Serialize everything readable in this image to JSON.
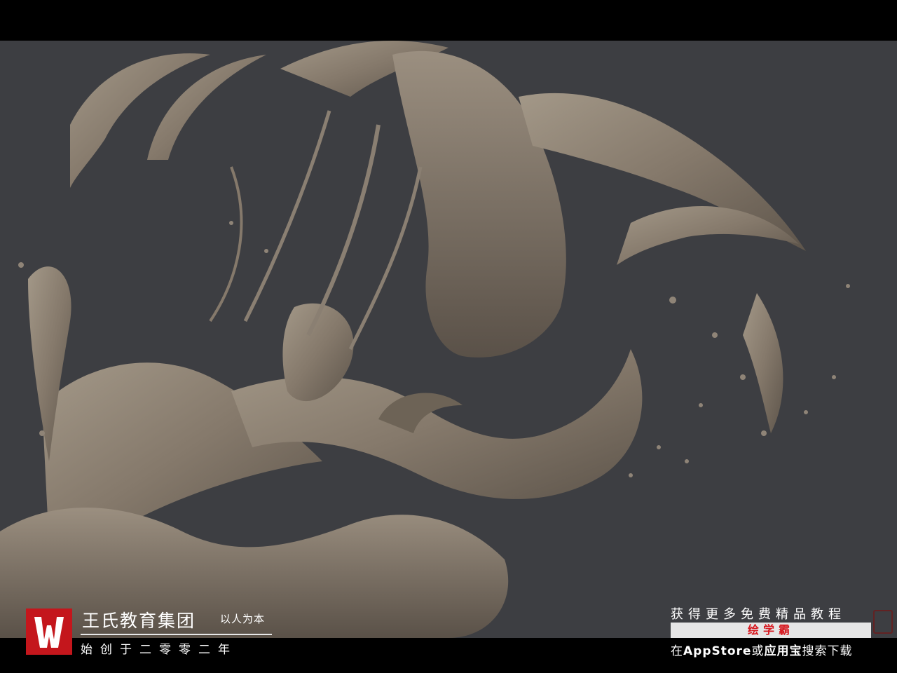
{
  "brand": {
    "name": "王氏教育集团",
    "motto": "以人为本",
    "founded": "始创于二零零二年",
    "logo_letter": "W",
    "logo_color": "#c4161c"
  },
  "promo": {
    "line1": "获得更多免费精品教程",
    "app_name": "绘学霸",
    "line3_prefix": "在",
    "line3_store1": "AppStore",
    "line3_mid": "或",
    "line3_store2": "应用宝",
    "line3_suffix": "搜索下载",
    "app_color": "#d71920"
  },
  "image": {
    "subject": "sculpted creature over splashing liquid",
    "background_color": "#3d3e42",
    "sculpt_color": "#8a7f72"
  }
}
